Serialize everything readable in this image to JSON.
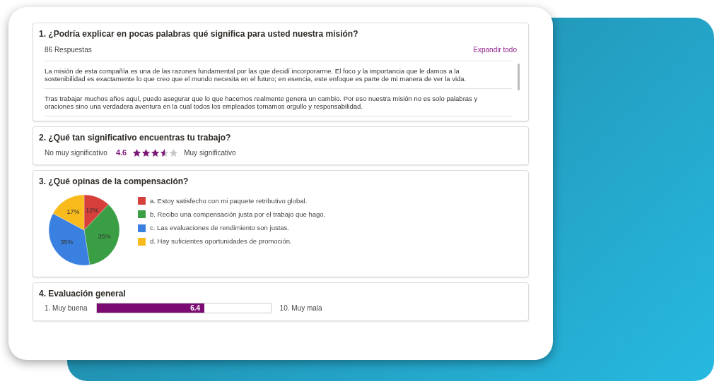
{
  "questions": [
    {
      "kind": "text",
      "title": "1. ¿Podría explicar en pocas palabras qué significa para usted nuestra misión?",
      "count": "86 Respuestas",
      "action": "Expandir todo",
      "answers": [
        "La misión de esta compañía es una de las razones fundamental por las que decidí incorporarme. El foco y la importancia que le damos a la sostenibilidad es exactamente lo que creo que el mundo necesita en el futuro; en esencia, este enfoque es parte de mi manera de ver la vida.",
        "Tras trabajar muchos años aquí, puedo asegurar que lo que hacemos realmente genera un cambio. Por eso nuestra misión no es solo palabras y oraciones sino una verdadera aventura en la cual todos los empleados tomamos orgullo y responsabilidad."
      ]
    },
    {
      "kind": "rating",
      "title": "2. ¿Qué tan significativo encuentras tu trabajo?",
      "low": "No muy significativo",
      "score": "4.6",
      "stars": 3.5,
      "high": "Muy significativo"
    },
    {
      "kind": "pie",
      "title": "3. ¿Qué opinas de la compensación?",
      "chart_data": {
        "type": "pie",
        "categories": [
          "a. Estoy satisfecho con mi paquete retributivo global.",
          "b. Recibo una compensación justa por el trabajo que hago.",
          "c. Las evaluaciones de rendimiento son justas.",
          "d. Hay suficientes oportunidades de promoción."
        ],
        "values": [
          12,
          35,
          35,
          17
        ],
        "value_labels": [
          "12%",
          "35%",
          "35%",
          "17%"
        ],
        "colors": [
          "#d63f3a",
          "#3a9e44",
          "#3a80e0",
          "#f9bb1c"
        ]
      }
    },
    {
      "kind": "scale",
      "title": "4. Evaluación general",
      "low": "1. Muy buena",
      "value": "6.4",
      "level": 0.62,
      "high": "10. Muy mala"
    }
  ]
}
